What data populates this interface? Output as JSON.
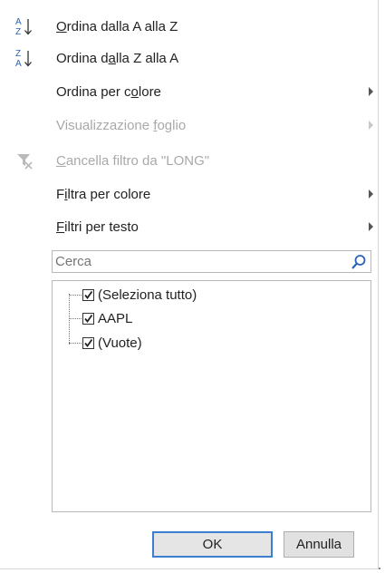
{
  "menu": {
    "sort_az": "Ordina dalla A alla Z",
    "sort_za": "Ordina dalla Z alla A",
    "sort_color": "Ordina per colore",
    "sheet_view": "Visualizzazione foglio",
    "clear_filter": "Cancella filtro da \"LONG\"",
    "filter_color": "Filtra per colore",
    "text_filters": "Filtri per testo"
  },
  "search": {
    "placeholder": "Cerca"
  },
  "list": {
    "items": [
      {
        "label": "(Seleziona tutto)",
        "checked": true
      },
      {
        "label": "AAPL",
        "checked": true
      },
      {
        "label": "(Vuote)",
        "checked": true
      }
    ]
  },
  "buttons": {
    "ok": "OK",
    "cancel": "Annulla"
  },
  "colors": {
    "ok_border": "#3c7fd1",
    "sort_icon_blue": "#2b63b8",
    "disabled_text": "#a9a9a9"
  },
  "icons": [
    "sort-ascending-icon",
    "sort-descending-icon",
    "clear-filter-icon",
    "search-icon",
    "checkbox-checked-icon"
  ]
}
